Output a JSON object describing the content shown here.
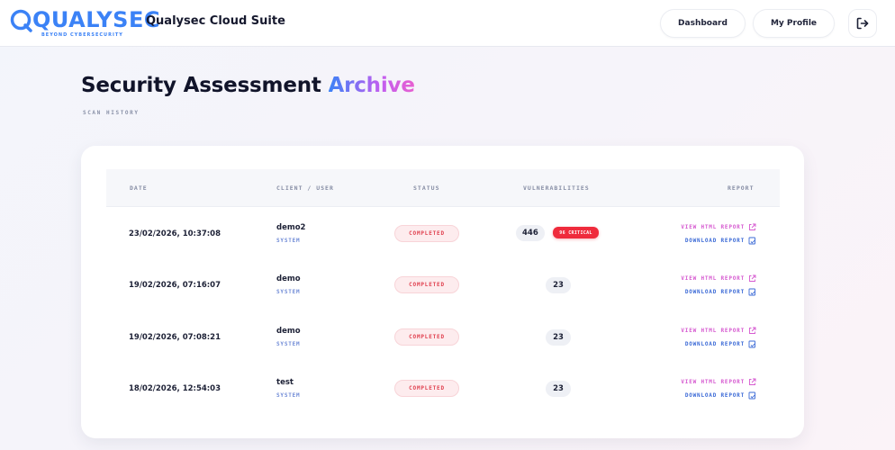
{
  "header": {
    "logo_text": "QUALYSEC",
    "logo_tagline": "BEYOND CYBERSECURITY",
    "app_title": "Qualysec Cloud Suite",
    "nav": {
      "dashboard": "Dashboard",
      "profile": "My Profile"
    },
    "logout_icon": "logout-icon"
  },
  "page": {
    "title_main": "Security Assessment",
    "title_accent": "Archive",
    "subtitle": "SCAN HISTORY"
  },
  "table": {
    "columns": {
      "date": "DATE",
      "client": "CLIENT / USER",
      "status": "STATUS",
      "vulns": "VULNERABILITIES",
      "report": "REPORT"
    },
    "report_labels": {
      "view": "VIEW HTML REPORT",
      "download": "DOWNLOAD REPORT"
    },
    "rows": [
      {
        "date": "23/02/2026, 10:37:08",
        "user": "demo2",
        "role": "SYSTEM",
        "status": "COMPLETED",
        "vulns": "446",
        "critical": "96 CRITICAL"
      },
      {
        "date": "19/02/2026, 07:16:07",
        "user": "demo",
        "role": "SYSTEM",
        "status": "COMPLETED",
        "vulns": "23",
        "critical": ""
      },
      {
        "date": "19/02/2026, 07:08:21",
        "user": "demo",
        "role": "SYSTEM",
        "status": "COMPLETED",
        "vulns": "23",
        "critical": ""
      },
      {
        "date": "18/02/2026, 12:54:03",
        "user": "test",
        "role": "SYSTEM",
        "status": "COMPLETED",
        "vulns": "23",
        "critical": ""
      }
    ]
  },
  "colors": {
    "brand_blue": "#3b82f6",
    "accent_pink": "#d65ad0",
    "status_red": "#e0404f",
    "critical_red": "#ef2b3c",
    "link_blue": "#3a69d6"
  }
}
